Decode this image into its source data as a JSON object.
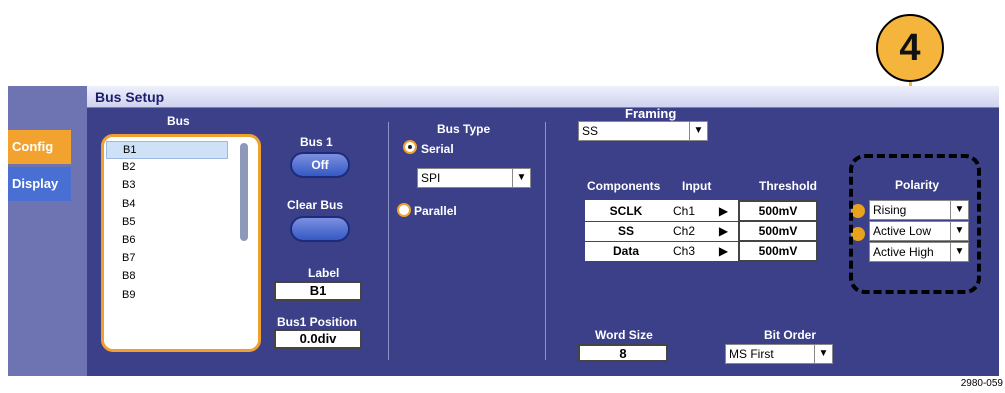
{
  "callout": {
    "number": "4"
  },
  "window": {
    "title": "Bus Setup"
  },
  "tabs": [
    {
      "label": "Config"
    },
    {
      "label": "Display"
    }
  ],
  "bus": {
    "header": "Bus",
    "items": [
      "B1",
      "B2",
      "B3",
      "B4",
      "B5",
      "B6",
      "B7",
      "B8",
      "B9"
    ],
    "selected": "B1"
  },
  "bus1": {
    "header": "Bus 1",
    "state": "Off"
  },
  "clear_bus": {
    "label": "Clear Bus"
  },
  "label_field": {
    "header": "Label",
    "value": "B1"
  },
  "position_field": {
    "header": "Bus1 Position",
    "value": "0.0div"
  },
  "bus_type": {
    "header": "Bus Type",
    "serial_label": "Serial",
    "parallel_label": "Parallel",
    "selected": "Serial",
    "protocol": "SPI"
  },
  "framing": {
    "header": "Framing",
    "value": "SS"
  },
  "components": {
    "headers": {
      "components": "Components",
      "input": "Input",
      "threshold": "Threshold"
    },
    "rows": [
      {
        "name": "SCLK",
        "input": "Ch1",
        "threshold": "500mV"
      },
      {
        "name": "SS",
        "input": "Ch2",
        "threshold": "500mV"
      },
      {
        "name": "Data",
        "input": "Ch3",
        "threshold": "500mV"
      }
    ]
  },
  "polarity": {
    "header": "Polarity",
    "values": [
      "Rising",
      "Active Low",
      "Active High"
    ]
  },
  "word_size": {
    "header": "Word Size",
    "value": "8"
  },
  "bit_order": {
    "header": "Bit Order",
    "value": "MS First"
  },
  "figure_number": "2980-059",
  "colors": {
    "accent": "#f0a030",
    "panel": "#3b4089",
    "frame": "#6e73b2"
  }
}
